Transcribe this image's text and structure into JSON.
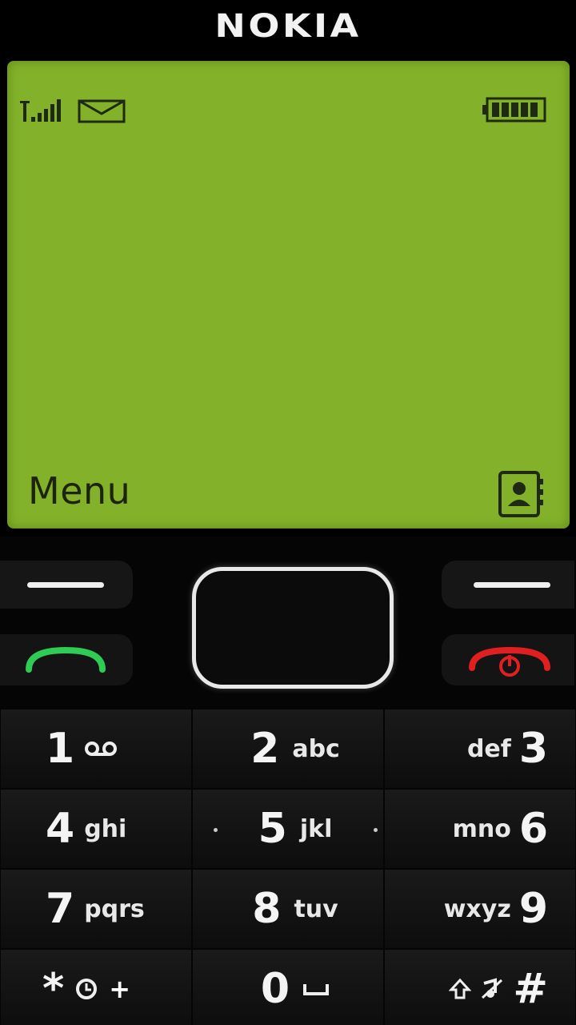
{
  "brand": {
    "name": "NOKIA"
  },
  "screen": {
    "background_color": "#83b22a",
    "status_icons": [
      "signal-strength-icon",
      "envelope-icon",
      "battery-icon"
    ],
    "left_softkey_label": "Menu",
    "right_softkey_icon": "contacts-icon"
  },
  "controls": {
    "call_color": "#2ecc55",
    "end_color": "#e02020"
  },
  "keypad": {
    "rows": [
      [
        {
          "digit": "1",
          "letters": "oo"
        },
        {
          "digit": "2",
          "letters": "abc"
        },
        {
          "digit": "3",
          "letters": "def"
        }
      ],
      [
        {
          "digit": "4",
          "letters": "ghi"
        },
        {
          "digit": "5",
          "letters": "jkl"
        },
        {
          "digit": "6",
          "letters": "mno"
        }
      ],
      [
        {
          "digit": "7",
          "letters": "pqrs"
        },
        {
          "digit": "8",
          "letters": "tuv"
        },
        {
          "digit": "9",
          "letters": "wxyz"
        }
      ],
      [
        {
          "digit": "*",
          "letters": "+"
        },
        {
          "digit": "0",
          "letters": ""
        },
        {
          "digit": "#",
          "letters": ""
        }
      ]
    ]
  }
}
